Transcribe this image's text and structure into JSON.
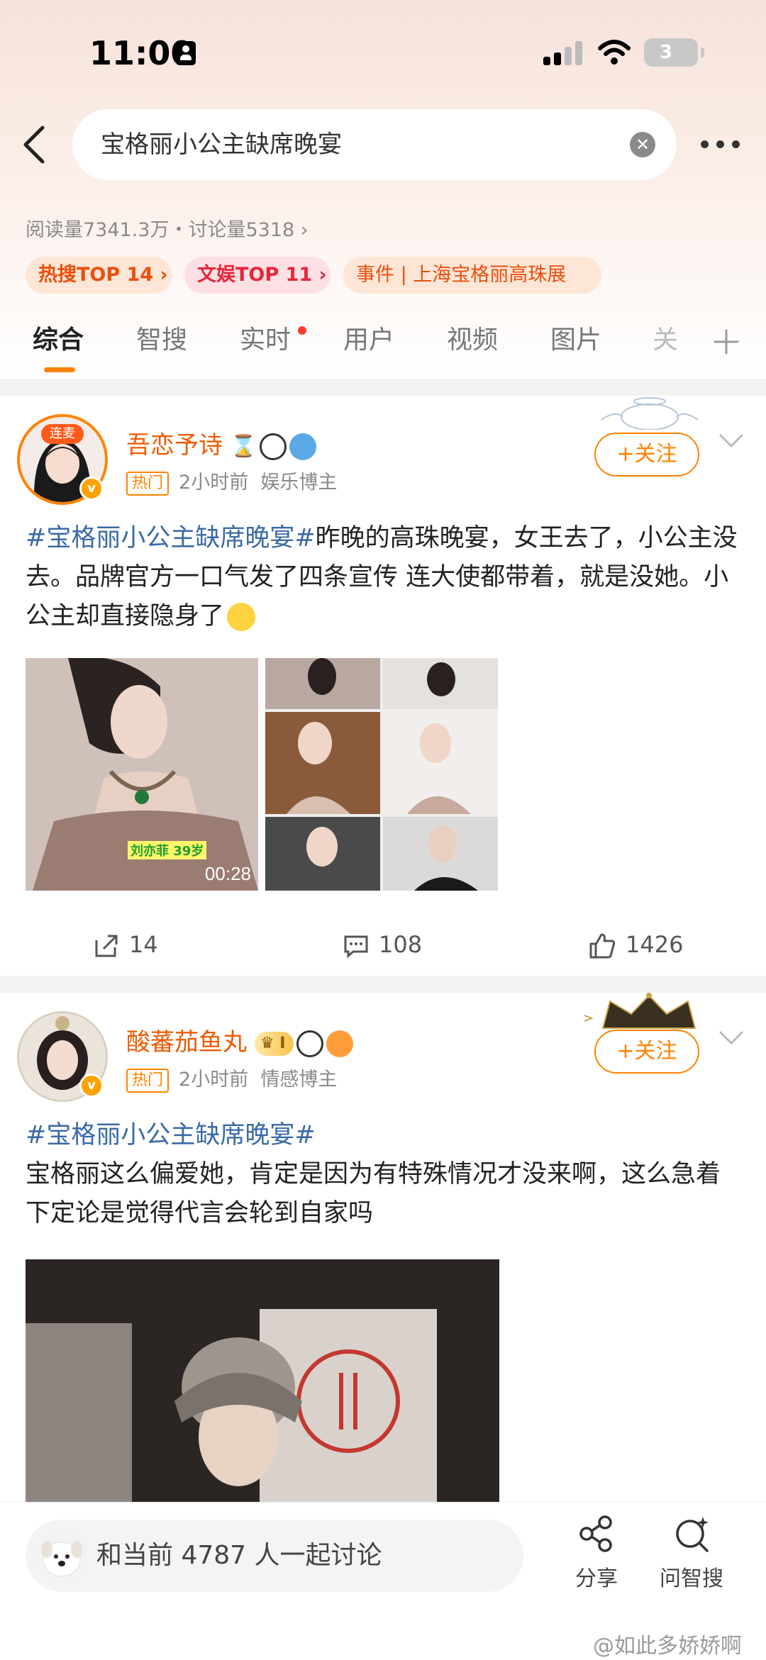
{
  "status_bar": {
    "time": "11:00",
    "battery": "3"
  },
  "search": {
    "query": "宝格丽小公主缺席晚宴"
  },
  "stats": {
    "text": "阅读量7341.3万・讨论量5318 ›"
  },
  "tags": [
    {
      "label": "热搜TOP 14 ›"
    },
    {
      "label": "文娱TOP 11 ›"
    },
    {
      "label": "事件 | 上海宝格丽高珠展"
    }
  ],
  "tabs": [
    "综合",
    "智搜",
    "实时",
    "用户",
    "视频",
    "图片",
    "关"
  ],
  "posts": [
    {
      "avatar_tag": "连麦",
      "username": "吾恋予诗",
      "hot": "热门",
      "time": "2小时前",
      "role": "娱乐博主",
      "follow": "+关注",
      "hashtag": "#宝格丽小公主缺席晚宴#",
      "body": "昨晚的高珠晚宴，女王去了，小公主没去。品牌官方一口气发了四条宣传 连大使都带着，就是没她。小公主却直接隐身了",
      "video_caption": "刘亦菲 39岁",
      "video_duration": "00:28",
      "reposts": "14",
      "comments": "108",
      "likes": "1426"
    },
    {
      "username": "酸蕃茄鱼丸",
      "level": "I",
      "hot": "热门",
      "time": "2小时前",
      "role": "情感博主",
      "follow": "+关注",
      "hashtag": "#宝格丽小公主缺席晚宴#",
      "body": "宝格丽这么偏爱她，肯定是因为有特殊情况才没来啊，这么急着下定论是觉得代言会轮到自家吗"
    }
  ],
  "bottom": {
    "discuss": "和当前 4787 人一起讨论",
    "share": "分享",
    "ask": "问智搜"
  },
  "watermark": "@如此多娇娇啊",
  "colors": {
    "accent": "#ff8200",
    "username": "#f05a00",
    "hashtag": "#3b6aa6"
  }
}
